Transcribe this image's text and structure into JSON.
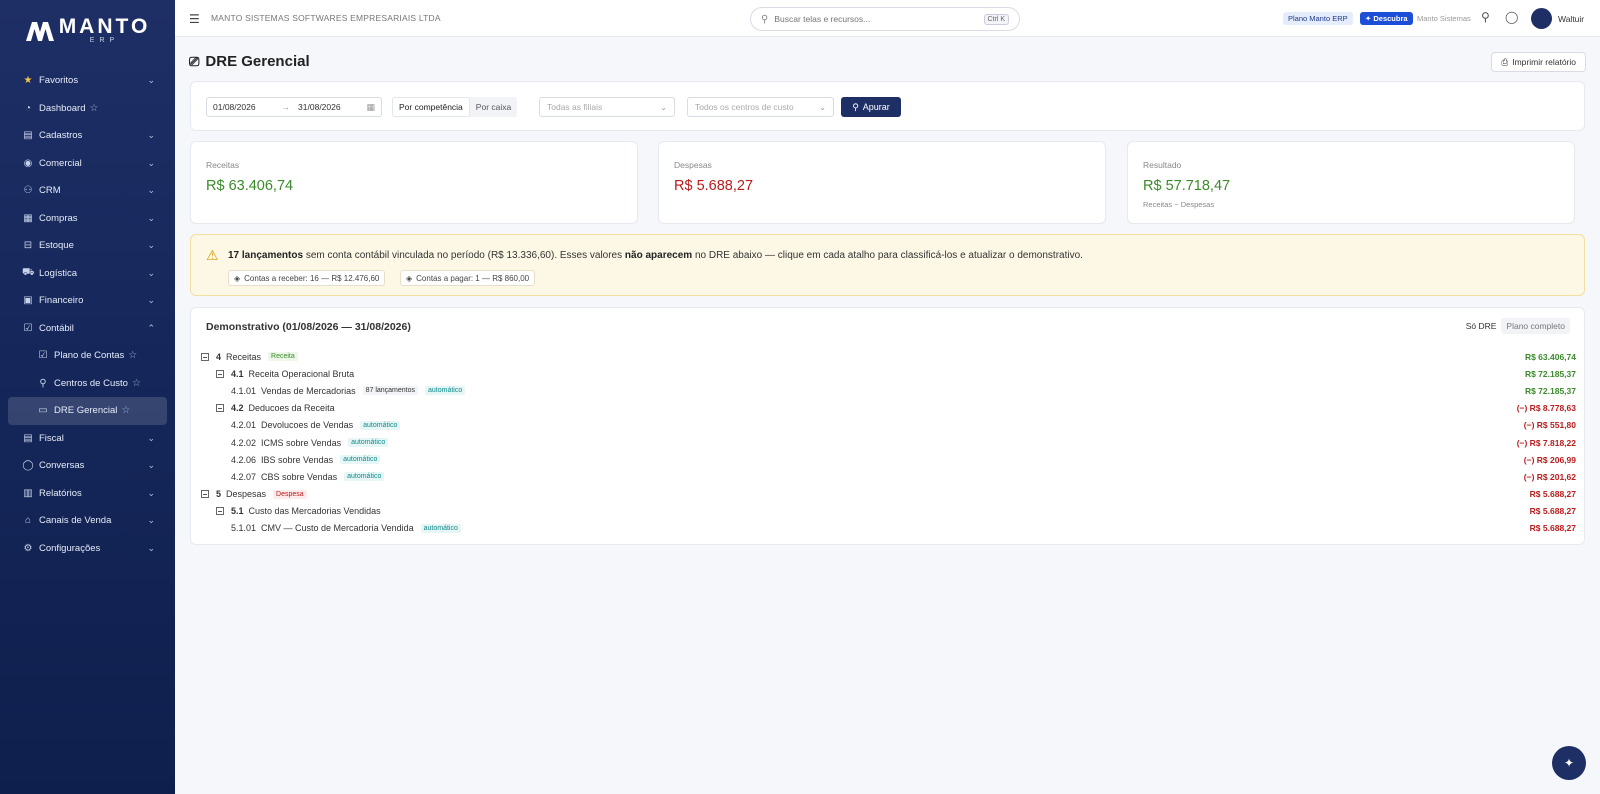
{
  "brand": {
    "name": "MANTO",
    "sub": "ERP"
  },
  "sidebar": {
    "items": [
      {
        "label": "Favoritos",
        "icon": "star-icon"
      },
      {
        "label": "Dashboard",
        "icon": "dashboard-icon"
      },
      {
        "label": "Cadastros",
        "icon": "register-icon"
      },
      {
        "label": "Comercial",
        "icon": "commercial-icon"
      },
      {
        "label": "CRM",
        "icon": "crm-icon"
      },
      {
        "label": "Compras",
        "icon": "cart-icon"
      },
      {
        "label": "Estoque",
        "icon": "box-icon"
      },
      {
        "label": "Logística",
        "icon": "truck-icon"
      },
      {
        "label": "Financeiro",
        "icon": "finance-icon"
      },
      {
        "label": "Contábil",
        "icon": "accounting-icon"
      },
      {
        "label": "Plano de Contas",
        "icon": "doc-icon"
      },
      {
        "label": "Centros de Custo",
        "icon": "hierarchy-icon"
      },
      {
        "label": "DRE Gerencial",
        "icon": "monitor-icon"
      },
      {
        "label": "Fiscal",
        "icon": "fiscal-icon"
      },
      {
        "label": "Conversas",
        "icon": "chat-icon"
      },
      {
        "label": "Relatórios",
        "icon": "chart-icon"
      },
      {
        "label": "Canais de Venda",
        "icon": "shop-icon"
      },
      {
        "label": "Configurações",
        "icon": "gear-icon"
      }
    ]
  },
  "topbar": {
    "company": "MANTO SISTEMAS SOFTWARES EMPRESARIAIS LTDA",
    "search_placeholder": "Buscar telas e recursos...",
    "search_shortcut": "Ctrl K",
    "plan_badge": "Plano Manto ERP",
    "discover_badge": "Descubra",
    "tenant": "Manto Sistemas",
    "user": "Waltuir"
  },
  "page": {
    "title": "DRE Gerencial",
    "print_label": "Imprimir relatório"
  },
  "filters": {
    "date_start": "01/08/2026",
    "date_end": "31/08/2026",
    "mode_competencia": "Por competência",
    "mode_caixa": "Por caixa",
    "branches_placeholder": "Todas as filiais",
    "cost_centers_placeholder": "Todos os centros de custo",
    "apply_label": "Apurar"
  },
  "kpis": {
    "receitas": {
      "label": "Receitas",
      "value": "R$ 63.406,74"
    },
    "despesas": {
      "label": "Despesas",
      "value": "R$ 5.688,27"
    },
    "resultado": {
      "label": "Resultado",
      "value": "R$ 57.718,47",
      "sub": "Receitas − Despesas"
    }
  },
  "alert": {
    "count": "17 lançamentos",
    "text1": " sem conta contábil vinculada no período (R$ 13.336,60). Esses valores ",
    "bold2": "não aparecem",
    "text2": " no DRE abaixo — clique em cada atalho para classificá-los e atualizar o demonstrativo.",
    "chip_receber": "Contas a receber: 16 — R$ 12.476,60",
    "chip_pagar": "Contas a pagar: 1 — R$ 860,00"
  },
  "dre": {
    "title": "Demonstrativo (01/08/2026 — 31/08/2026)",
    "toggle_on": "Só DRE",
    "toggle_off": "Plano completo",
    "rows": [
      {
        "code": "4",
        "name": "Receitas",
        "tag": "Receita",
        "amount": "R$ 63.406,74"
      },
      {
        "code": "4.1",
        "name": "Receita Operacional Bruta",
        "amount": "R$ 72.185,37"
      },
      {
        "code": "4.1.01",
        "name": "Vendas de Mercadorias",
        "count": "87 lançamentos",
        "tag": "automático",
        "amount": "R$ 72.185,37"
      },
      {
        "code": "4.2",
        "name": "Deducoes da Receita",
        "amount": "(−) R$ 8.778,63"
      },
      {
        "code": "4.2.01",
        "name": "Devolucoes de Vendas",
        "tag": "automático",
        "amount": "(−) R$ 551,80"
      },
      {
        "code": "4.2.02",
        "name": "ICMS sobre Vendas",
        "tag": "automático",
        "amount": "(−) R$ 7.818,22"
      },
      {
        "code": "4.2.06",
        "name": "IBS sobre Vendas",
        "tag": "automático",
        "amount": "(−) R$ 206,99"
      },
      {
        "code": "4.2.07",
        "name": "CBS sobre Vendas",
        "tag": "automático",
        "amount": "(−) R$ 201,62"
      },
      {
        "code": "5",
        "name": "Despesas",
        "tag": "Despesa",
        "amount": "R$ 5.688,27"
      },
      {
        "code": "5.1",
        "name": "Custo das Mercadorias Vendidas",
        "amount": "R$ 5.688,27"
      },
      {
        "code": "5.1.01",
        "name": "CMV — Custo de Mercadoria Vendida",
        "tag": "automático",
        "amount": "R$ 5.688,27"
      }
    ]
  },
  "colors": {
    "primary": "#1e2f66",
    "positive": "#3b8a2b",
    "negative": "#b91c1c",
    "warning_bg": "#fdf8e6"
  }
}
